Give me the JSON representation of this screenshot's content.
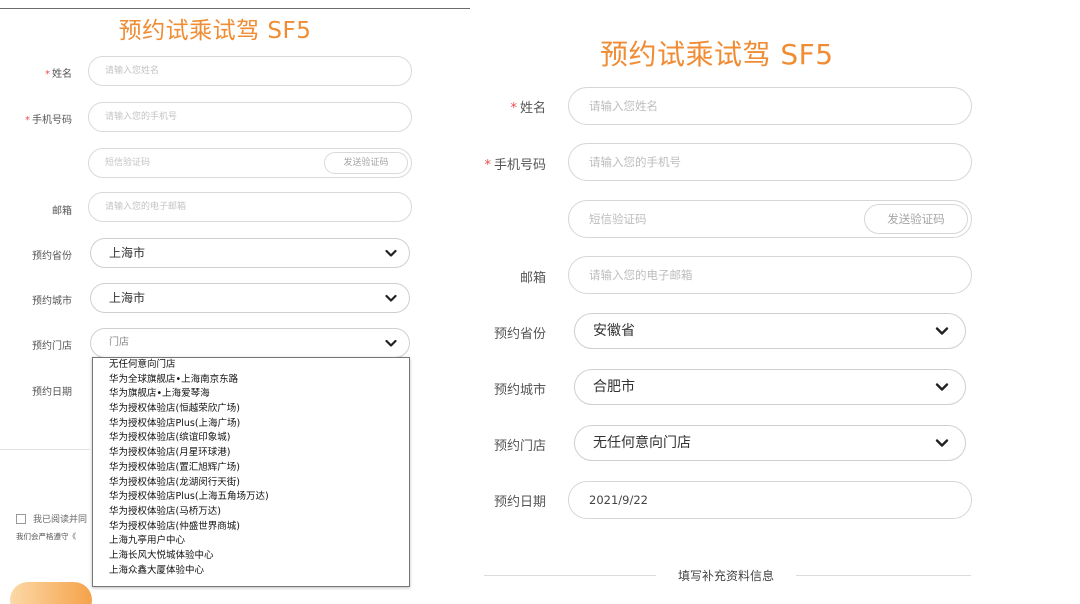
{
  "left_panel": {
    "title": "预约试乘试驾 SF5",
    "name_label": "姓名",
    "name_placeholder": "请输入您姓名",
    "phone_label": "手机号码",
    "phone_placeholder": "请输入您的手机号",
    "sms_placeholder": "短信验证码",
    "send_code_label": "发送验证码",
    "email_label": "邮箱",
    "email_placeholder": "请输入您的电子邮箱",
    "province_label": "预约省份",
    "province_value": "上海市",
    "city_label": "预约城市",
    "city_value": "上海市",
    "store_label": "预约门店",
    "store_value": "门店",
    "date_label": "预约日期",
    "store_options": [
      "无任何意向门店",
      "华为全球旗舰店•上海南京东路",
      "华为旗舰店•上海爱琴海",
      "华为授权体验店(恒越荣欣广场)",
      "华为授权体验店Plus(上海广场)",
      "华为授权体验店(缤谊印象城)",
      "华为授权体验店(月星环球港)",
      "华为授权体验店(置汇旭辉广场)",
      "华为授权体验店(龙湖闵行天街)",
      "华为授权体验店Plus(上海五角场万达)",
      "华为授权体验店(马桥万达)",
      "华为授权体验店(仲盛世界商城)",
      "上海九亭用户中心",
      "上海长风大悦城体验中心",
      "上海众鑫大厦体验中心"
    ],
    "agree_text": "我已阅读并同",
    "privacy_note": "我们会严格遵守《"
  },
  "right_panel": {
    "title": "预约试乘试驾 SF5",
    "name_label": "姓名",
    "name_placeholder": "请输入您姓名",
    "phone_label": "手机号码",
    "phone_placeholder": "请输入您的手机号",
    "sms_placeholder": "短信验证码",
    "send_code_label": "发送验证码",
    "email_label": "邮箱",
    "email_placeholder": "请输入您的电子邮箱",
    "province_label": "预约省份",
    "province_value": "安徽省",
    "city_label": "预约城市",
    "city_value": "合肥市",
    "store_label": "预约门店",
    "store_value": "无任何意向门店",
    "date_label": "预约日期",
    "date_value": "2021/9/22",
    "supplement_divider": "填写补充资料信息"
  },
  "colors": {
    "accent_orange": "#f08c33",
    "required_star": "#e94d4d",
    "input_border": "#d6d6d6",
    "placeholder": "#bdbdbd"
  },
  "icons": {
    "select_arrow": "chevron-down-icon"
  }
}
